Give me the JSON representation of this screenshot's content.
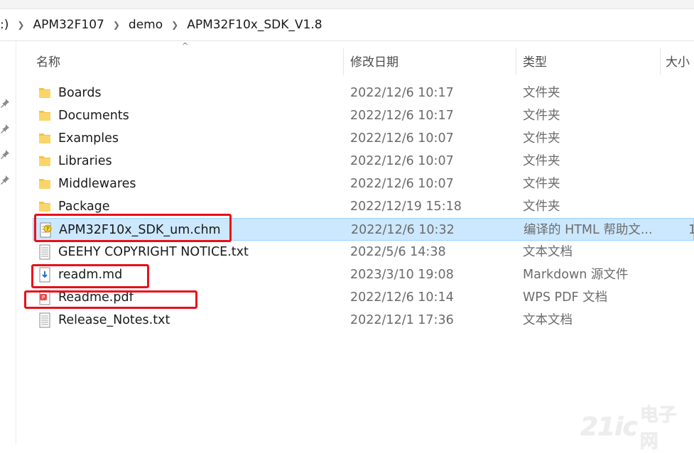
{
  "breadcrumb": {
    "items": [
      ":)",
      "APM32F107",
      "demo",
      "APM32F10x_SDK_V1.8"
    ]
  },
  "columns": {
    "name": "名称",
    "date": "修改日期",
    "type": "类型",
    "size": "大小",
    "sort_indicator": "^"
  },
  "files": [
    {
      "icon": "folder-icon",
      "name": "Boards",
      "date": "2022/12/6 10:17",
      "type": "文件夹",
      "size": ""
    },
    {
      "icon": "folder-icon",
      "name": "Documents",
      "date": "2022/12/6 10:17",
      "type": "文件夹",
      "size": ""
    },
    {
      "icon": "folder-icon",
      "name": "Examples",
      "date": "2022/12/6 10:07",
      "type": "文件夹",
      "size": ""
    },
    {
      "icon": "folder-icon",
      "name": "Libraries",
      "date": "2022/12/6 10:07",
      "type": "文件夹",
      "size": ""
    },
    {
      "icon": "folder-icon",
      "name": "Middlewares",
      "date": "2022/12/6 10:07",
      "type": "文件夹",
      "size": ""
    },
    {
      "icon": "folder-icon",
      "name": "Package",
      "date": "2022/12/19 15:18",
      "type": "文件夹",
      "size": ""
    },
    {
      "icon": "chm-help-icon",
      "name": "APM32F10x_SDK_um.chm",
      "date": "2022/12/6 10:32",
      "type": "编译的 HTML 帮助文...",
      "size": "1",
      "selected": true
    },
    {
      "icon": "text-file-icon",
      "name": "GEEHY COPYRIGHT NOTICE.txt",
      "date": "2022/5/6 14:38",
      "type": "文本文档",
      "size": ""
    },
    {
      "icon": "markdown-file-icon",
      "name": "readm.md",
      "date": "2023/3/10 19:08",
      "type": "Markdown 源文件",
      "size": ""
    },
    {
      "icon": "pdf-file-icon",
      "name": "Readme.pdf",
      "date": "2022/12/6 10:14",
      "type": "WPS PDF 文档",
      "size": ""
    },
    {
      "icon": "text-file-icon",
      "name": "Release_Notes.txt",
      "date": "2022/12/1 17:36",
      "type": "文本文档",
      "size": ""
    }
  ],
  "watermark": {
    "logo": "21ic",
    "text": "电子网"
  },
  "colors": {
    "selection_bg": "#cce8ff",
    "selection_border": "#99d1ff",
    "annotation_red": "#e8101a",
    "folder_yellow": "#f5c242"
  }
}
